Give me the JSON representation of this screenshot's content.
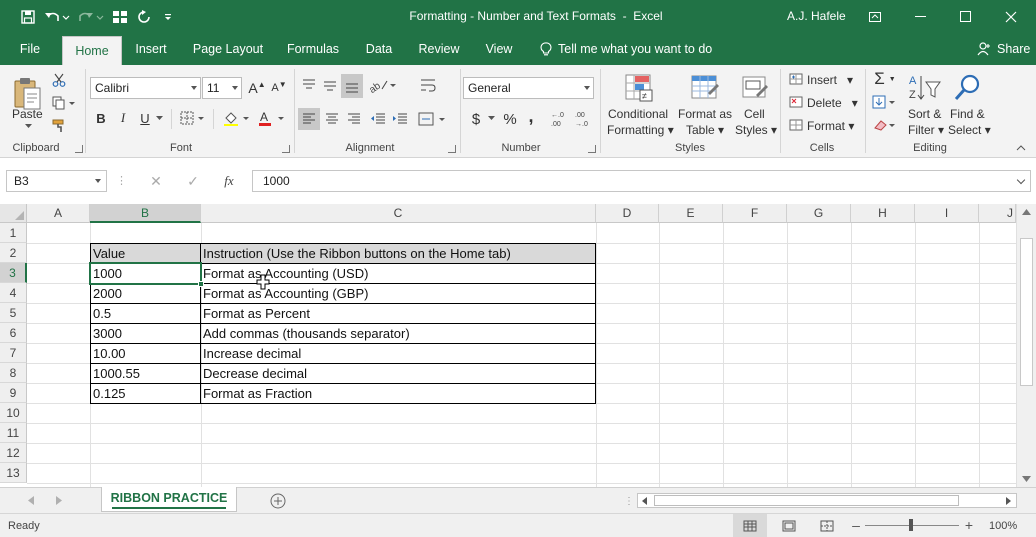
{
  "window": {
    "title": "Formatting - Number and Text Formats",
    "app": "Excel",
    "user": "A.J. Hafele"
  },
  "tabs": [
    {
      "label": "File"
    },
    {
      "label": "Home"
    },
    {
      "label": "Insert"
    },
    {
      "label": "Page Layout"
    },
    {
      "label": "Formulas"
    },
    {
      "label": "Data"
    },
    {
      "label": "Review"
    },
    {
      "label": "View"
    }
  ],
  "tellme": "Tell me what you want to do",
  "share": "Share",
  "ribbon": {
    "clipboard": {
      "label": "Clipboard",
      "paste": "Paste"
    },
    "font": {
      "label": "Font",
      "name": "Calibri",
      "size": "11",
      "bold": "B",
      "italic": "I",
      "underline": "U"
    },
    "alignment": {
      "label": "Alignment"
    },
    "number": {
      "label": "Number",
      "format": "General",
      "currency": "$",
      "percent": "%",
      "comma": ","
    },
    "styles": {
      "label": "Styles",
      "conditional_1": "Conditional",
      "conditional_2": "Formatting",
      "table_1": "Format as",
      "table_2": "Table",
      "cell_1": "Cell",
      "cell_2": "Styles"
    },
    "cells": {
      "label": "Cells",
      "insert": "Insert",
      "delete": "Delete",
      "format": "Format"
    },
    "editing": {
      "label": "Editing",
      "sort_1": "Sort &",
      "sort_2": "Filter",
      "find_1": "Find &",
      "find_2": "Select"
    }
  },
  "formula_bar": {
    "name_box": "B3",
    "fx": "fx",
    "value": "1000"
  },
  "columns": [
    "A",
    "B",
    "C",
    "D",
    "E",
    "F",
    "G",
    "H",
    "I",
    "J"
  ],
  "rows": [
    "1",
    "2",
    "3",
    "4",
    "5",
    "6",
    "7",
    "8",
    "9",
    "10",
    "11",
    "12",
    "13"
  ],
  "table": {
    "header": {
      "value": "Value",
      "instruction": "Instruction (Use the Ribbon buttons on the Home tab)"
    },
    "rows": [
      {
        "value": "1000",
        "instruction": "Format as Accounting (USD)"
      },
      {
        "value": "2000",
        "instruction": "Format as Accounting (GBP)"
      },
      {
        "value": "0.5",
        "instruction": "Format as Percent"
      },
      {
        "value": "3000",
        "instruction": "Add commas (thousands separator)"
      },
      {
        "value": "10.00",
        "instruction": "Increase decimal"
      },
      {
        "value": "1000.55",
        "instruction": "Decrease decimal"
      },
      {
        "value": "0.125",
        "instruction": "Format as Fraction"
      }
    ]
  },
  "sheet_tab": "RIBBON PRACTICE",
  "status": {
    "ready": "Ready",
    "zoom": "100%"
  },
  "colors": {
    "accent": "#217346",
    "header_fill": "#d9d9d9"
  }
}
